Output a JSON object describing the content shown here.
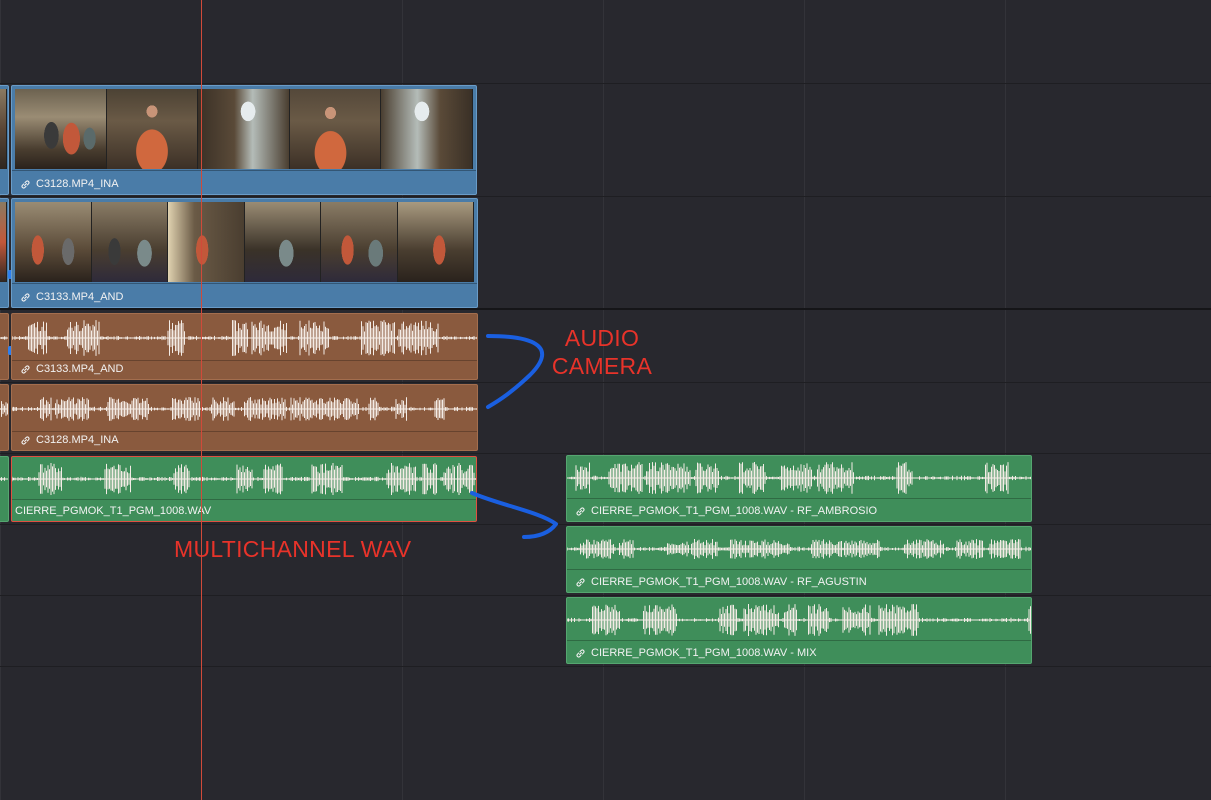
{
  "clips": {
    "v2": "C3128.MP4_INA",
    "v1": "C3133.MP4_AND",
    "a1": "C3133.MP4_AND",
    "a2": "C3128.MP4_INA",
    "a3": "CIERRE_PGMOK_T1_PGM_1008.WAV",
    "a3_ch1": "CIERRE_PGMOK_T1_PGM_1008.WAV - RF_AMBROSIO",
    "a3_ch2": "CIERRE_PGMOK_T1_PGM_1008.WAV - RF_AGUSTIN",
    "a3_mix": "CIERRE_PGMOK_T1_PGM_1008.WAV - MIX"
  },
  "annotations": {
    "audio_camera_line1": "AUDIO",
    "audio_camera_line2": "CAMERA",
    "multichannel": "MULTICHANNEL WAV"
  },
  "icons": {
    "link": "link-icon",
    "marker": "marker-icon"
  },
  "colors": {
    "background": "#28282e",
    "video_clip": "#4a7ca8",
    "camera_audio_clip": "#8a5a3e",
    "wav_audio_clip": "#3f8e5a",
    "playhead": "#d04a3a",
    "annotation_text": "#e8332a",
    "annotation_arrow": "#1a5fe0"
  }
}
